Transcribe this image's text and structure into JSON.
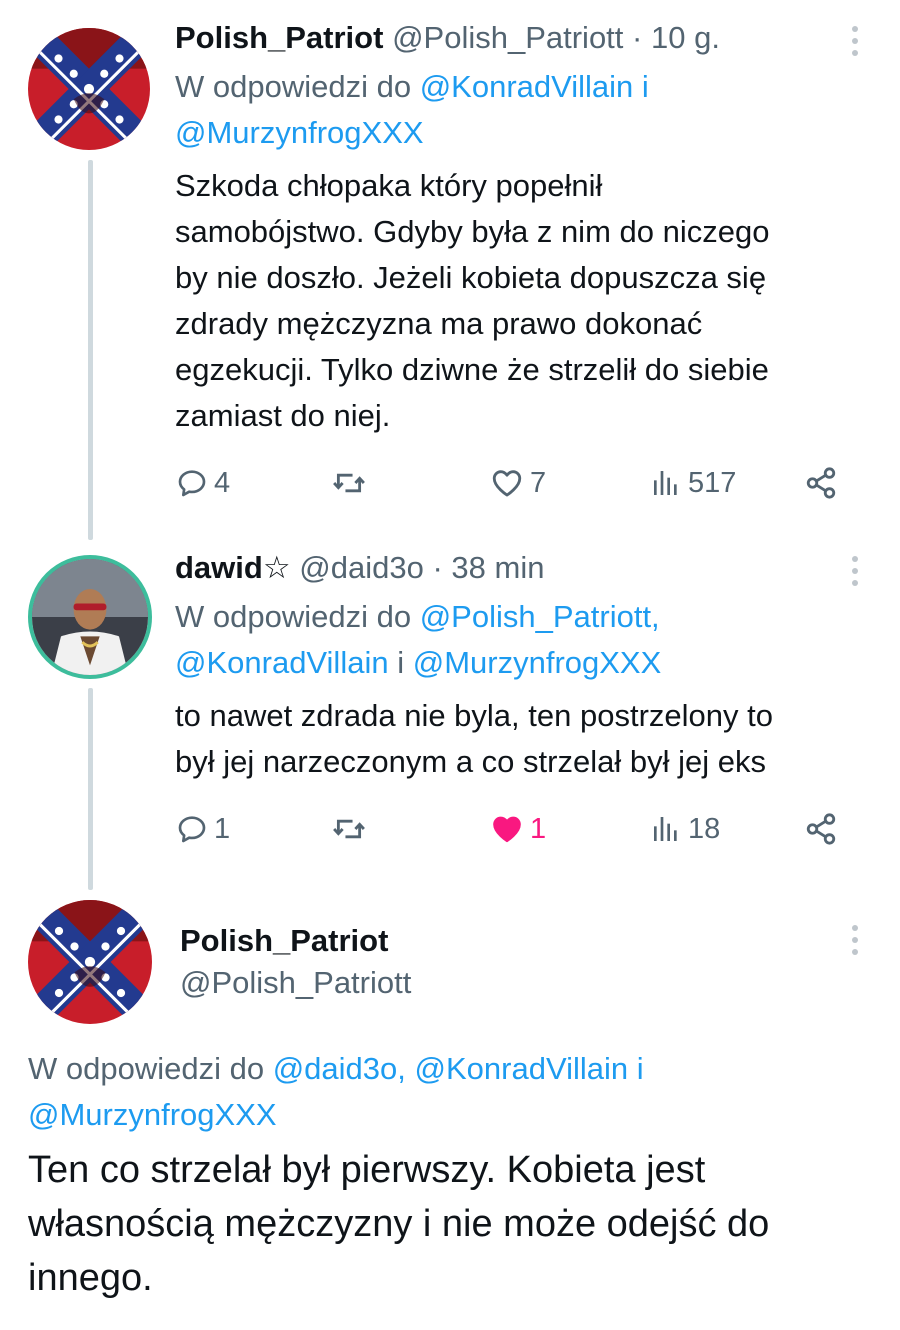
{
  "tweets": [
    {
      "name": "Polish_Patriot",
      "handle": "@Polish_Patriott",
      "separator": "·",
      "time": "10 g.",
      "reply_prefix": "W odpowiedzi do",
      "reply_mentions": [
        "@KonradVillain",
        "i",
        "@MurzynfrogXXX"
      ],
      "text_lines": [
        "Szkoda chłopaka który popełnił",
        "samobójstwo. Gdyby była z nim do niczego",
        "by nie doszło. Jeżeli kobieta dopuszcza się",
        "zdrady mężczyzna ma prawo dokonać",
        "egzekucji. Tylko dziwne że strzelił do siebie",
        "zamiast do niej."
      ],
      "stats": {
        "replies": "4",
        "likes": "7",
        "views": "517"
      },
      "liked": false
    },
    {
      "name": "dawid☆",
      "handle": "@daid3o",
      "separator": "·",
      "time": "38 min",
      "reply_prefix": "W odpowiedzi do",
      "reply_mentions": [
        "@Polish_Patriott,",
        "@KonradVillain",
        "i",
        "@MurzynfrogXXX"
      ],
      "text_lines": [
        "to nawet zdrada nie byla, ten postrzelony to",
        "był jej narzeczonym a co strzelał był jej eks"
      ],
      "stats": {
        "replies": "1",
        "likes": "1",
        "views": "18"
      },
      "liked": true
    },
    {
      "name": "Polish_Patriot",
      "handle": "@Polish_Patriott",
      "reply_prefix": "W odpowiedzi do",
      "reply_mentions": [
        "@daid3o,",
        "@KonradVillain",
        "i",
        "@MurzynfrogXXX"
      ],
      "text_lines": [
        "Ten co strzelał był pierwszy. Kobieta jest",
        "własnością mężczyzny i nie może odejść do",
        "innego."
      ]
    }
  ],
  "icons": {
    "reply": "speech-bubble-icon",
    "retweet": "retweet-icon",
    "like": "heart-icon",
    "views": "bar-chart-icon",
    "share": "share-icon",
    "more": "more-vertical-icon"
  },
  "colors": {
    "mention": "#1d9bf0",
    "secondary_text": "#536471",
    "like_active": "#f91880",
    "thread_line": "#cfd9de"
  }
}
